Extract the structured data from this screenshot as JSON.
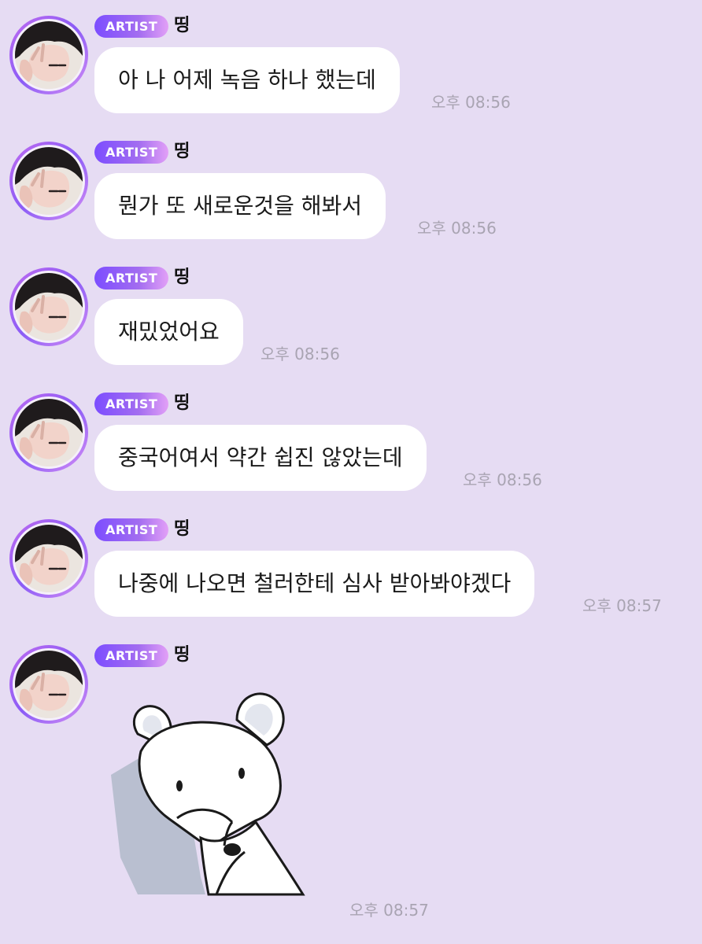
{
  "messages": [
    {
      "badge": "ARTIST",
      "name": "띵",
      "text": "아 나 어제 녹음 하나 했는데",
      "time": "오후 08:56"
    },
    {
      "badge": "ARTIST",
      "name": "띵",
      "text": "뭔가 또 새로운것을 해봐서",
      "time": "오후 08:56"
    },
    {
      "badge": "ARTIST",
      "name": "띵",
      "text": "재밌었어요",
      "time": "오후 08:56"
    },
    {
      "badge": "ARTIST",
      "name": "띵",
      "text": "중국어여서 약간 쉽진 않았는데",
      "time": "오후 08:56"
    },
    {
      "badge": "ARTIST",
      "name": "띵",
      "text": "나중에 나오면 철러한테 심사 받아봐야겠다",
      "time": "오후 08:57"
    }
  ],
  "sticker_message": {
    "badge": "ARTIST",
    "name": "띵",
    "sticker": "white-mouse-sticker",
    "time": "오후 08:57"
  },
  "colors": {
    "background": "#e6dcf3",
    "bubble": "#ffffff",
    "badge_start": "#7c4dff",
    "badge_end": "#e2a0f7",
    "timestamp": "#a9a4b2"
  }
}
